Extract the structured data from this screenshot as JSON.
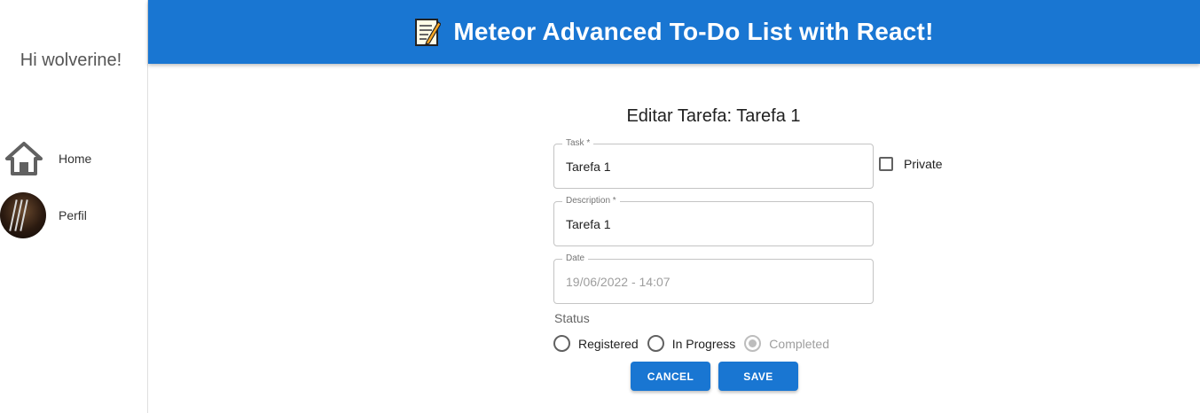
{
  "sidebar": {
    "greeting": "Hi wolverine!",
    "items": [
      {
        "label": "Home",
        "icon": "home-icon"
      },
      {
        "label": "Perfil",
        "icon": "avatar"
      }
    ]
  },
  "header": {
    "title": "Meteor Advanced To-Do List with React!",
    "icon": "memo-icon",
    "color": "#1976d2"
  },
  "form": {
    "title": "Editar Tarefa: Tarefa 1",
    "task": {
      "legend": "Task *",
      "value": "Tarefa 1"
    },
    "description": {
      "legend": "Description *",
      "value": "Tarefa 1"
    },
    "date": {
      "legend": "Date",
      "value": "19/06/2022 - 14:07"
    },
    "private_label": "Private",
    "private_checked": false,
    "status_label": "Status",
    "status_options": [
      {
        "label": "Registered",
        "disabled": false
      },
      {
        "label": "In Progress",
        "disabled": false
      },
      {
        "label": "Completed",
        "disabled": true
      }
    ],
    "cancel_label": "CANCEL",
    "save_label": "SAVE"
  }
}
